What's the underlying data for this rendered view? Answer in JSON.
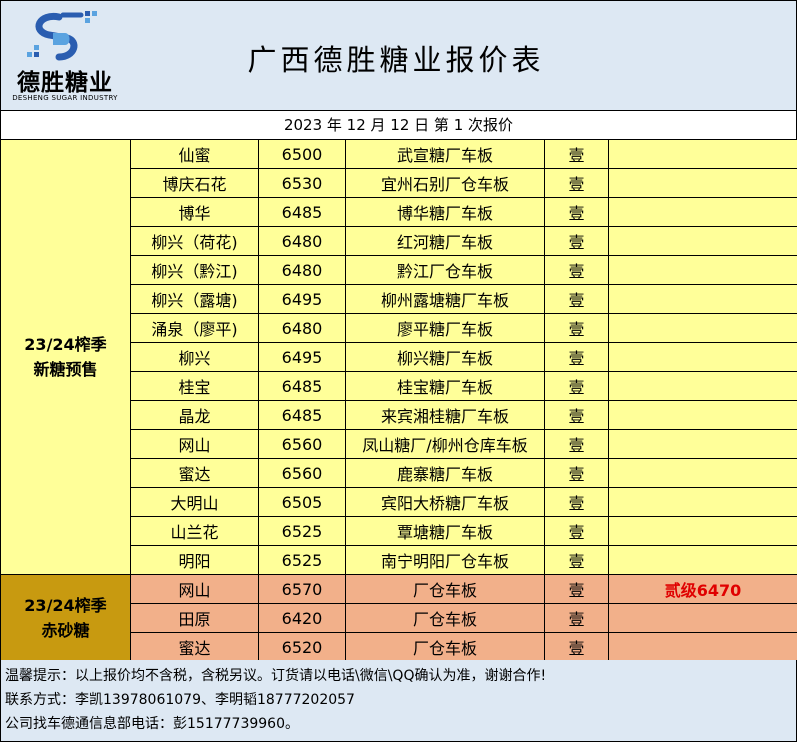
{
  "logo": {
    "name": "德胜糖业",
    "subtitle": "DESHENG SUGAR INDUSTRY"
  },
  "title": "广西德胜糖业报价表",
  "dateline": "2023 年 12 月 12 日  第 1 次报价",
  "groups": [
    {
      "label_line1": "23/24榨季",
      "label_line2": "新糖预售",
      "rows": [
        {
          "brand": "仙蜜",
          "price": "6500",
          "location": "武宣糖厂车板",
          "grade": "壹",
          "note": ""
        },
        {
          "brand": "博庆石花",
          "price": "6530",
          "location": "宜州石别厂仓车板",
          "grade": "壹",
          "note": ""
        },
        {
          "brand": "博华",
          "price": "6485",
          "location": "博华糖厂车板",
          "grade": "壹",
          "note": ""
        },
        {
          "brand": "柳兴（荷花)",
          "price": "6480",
          "location": "红河糖厂车板",
          "grade": "壹",
          "note": ""
        },
        {
          "brand": "柳兴（黔江)",
          "price": "6480",
          "location": "黔江厂仓车板",
          "grade": "壹",
          "note": ""
        },
        {
          "brand": "柳兴（露塘)",
          "price": "6495",
          "location": "柳州露塘糖厂车板",
          "grade": "壹",
          "note": ""
        },
        {
          "brand": "涌泉（廖平)",
          "price": "6480",
          "location": "廖平糖厂车板",
          "grade": "壹",
          "note": ""
        },
        {
          "brand": "柳兴",
          "price": "6495",
          "location": "柳兴糖厂车板",
          "grade": "壹",
          "note": ""
        },
        {
          "brand": "桂宝",
          "price": "6485",
          "location": "桂宝糖厂车板",
          "grade": "壹",
          "note": ""
        },
        {
          "brand": "晶龙",
          "price": "6485",
          "location": "来宾湘桂糖厂车板",
          "grade": "壹",
          "note": ""
        },
        {
          "brand": "网山",
          "price": "6560",
          "location": "凤山糖厂/柳州仓库车板",
          "grade": "壹",
          "note": ""
        },
        {
          "brand": "蜜达",
          "price": "6560",
          "location": "鹿寨糖厂车板",
          "grade": "壹",
          "note": ""
        },
        {
          "brand": "大明山",
          "price": "6505",
          "location": "宾阳大桥糖厂车板",
          "grade": "壹",
          "note": ""
        },
        {
          "brand": "山兰花",
          "price": "6525",
          "location": "覃塘糖厂车板",
          "grade": "壹",
          "note": ""
        },
        {
          "brand": "明阳",
          "price": "6525",
          "location": "南宁明阳厂仓车板",
          "grade": "壹",
          "note": ""
        }
      ]
    },
    {
      "label_line1": "23/24榨季",
      "label_line2": "赤砂糖",
      "rows": [
        {
          "brand": "网山",
          "price": "6570",
          "location": "厂仓车板",
          "grade": "壹",
          "note": "贰级6470"
        },
        {
          "brand": "田原",
          "price": "6420",
          "location": "厂仓车板",
          "grade": "壹",
          "note": ""
        },
        {
          "brand": "蜜达",
          "price": "6520",
          "location": "厂仓车板",
          "grade": "壹",
          "note": ""
        }
      ]
    }
  ],
  "footer": {
    "line1": "温馨提示：以上报价均不含税，含税另议。订货请以电话\\微信\\QQ确认为准，谢谢合作!",
    "line2": "联系方式：李凯13978061079、李明韬18777202057",
    "line3": "公司找车德通信息部电话：彭15177739960。"
  },
  "colors": {
    "new_row": "#ffff99",
    "red_row": "#f2b08a",
    "red_group": "#c89a10",
    "header_bg": "#dde8f3",
    "note_red": "#e00000"
  }
}
